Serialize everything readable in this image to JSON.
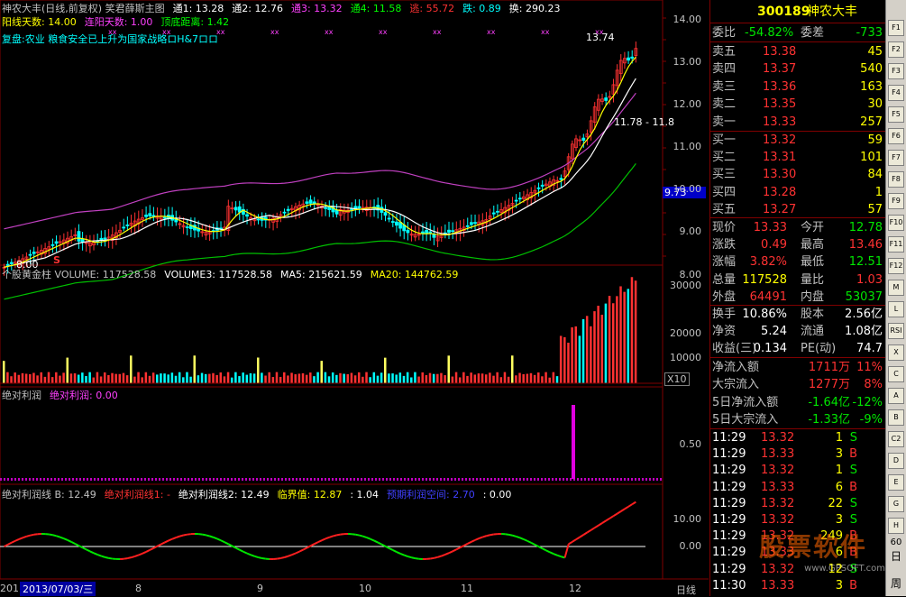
{
  "main_panel": {
    "header": [
      {
        "text": "神农大丰(日线,前复权) 笑君薛斯主图",
        "color": "#c0c0c0"
      },
      {
        "text": "通1: 13.28",
        "color": "#ffffff"
      },
      {
        "text": "通2: 12.76",
        "color": "#ffffff"
      },
      {
        "text": "通3: 13.32",
        "color": "#ff40ff"
      },
      {
        "text": "通4: 11.58",
        "color": "#00ff00"
      },
      {
        "text": "逃: 55.72",
        "color": "#ff3232"
      },
      {
        "text": "跌: 0.89",
        "color": "#00ffff"
      },
      {
        "text": "换: 290.23",
        "color": "#ffffff"
      }
    ],
    "header2": [
      {
        "text": "阳线天数: 14.00",
        "color": "#ffff00"
      },
      {
        "text": "连阳天数: 1.00",
        "color": "#ff40ff"
      },
      {
        "text": "顶底距离: 1.42",
        "color": "#00ff00"
      }
    ],
    "fupan": "复盘:农业 粮食安全已上升为国家战略ロH&7ロロ",
    "y_ticks": [
      "14.00",
      "13.00",
      "12.00",
      "11.00",
      "10.00",
      "9.00",
      "8.00"
    ],
    "high_label": "13.74",
    "mid_label": "11.78 - 11.8",
    "low_label": "8.00",
    "price_tag": "9.73",
    "s_marker": "S"
  },
  "volume_panel": {
    "header": [
      {
        "text": "个股黄金柱 VOLUME: 117528.58",
        "color": "#c0c0c0"
      },
      {
        "text": "VOLUME3: 117528.58",
        "color": "#ffffff"
      },
      {
        "text": "MA5: 215621.59",
        "color": "#ffffff"
      },
      {
        "text": "MA20: 144762.59",
        "color": "#ffff00"
      }
    ],
    "y_ticks": [
      "30000",
      "20000",
      "10000"
    ],
    "unit": "X10"
  },
  "profit_panel": {
    "header": [
      {
        "text": "绝对利润",
        "color": "#c0c0c0"
      },
      {
        "text": "绝对利润: 0.00",
        "color": "#ff40ff"
      }
    ],
    "y_ticks": [
      "0.50"
    ]
  },
  "line_panel": {
    "header": [
      {
        "text": "绝对利润线 B: 12.49",
        "color": "#c0c0c0"
      },
      {
        "text": "绝对利润线1: -",
        "color": "#ff3232"
      },
      {
        "text": "绝对利润线2: 12.49",
        "color": "#ffffff"
      },
      {
        "text": "临界值: 12.87",
        "color": "#ffff00"
      },
      {
        "text": ": 1.04",
        "color": "#ffffff"
      },
      {
        "text": "预期利润空间: 2.70",
        "color": "#4040ff"
      },
      {
        "text": ": 0.00",
        "color": "#ffffff"
      }
    ],
    "y_ticks": [
      "10.00",
      "0.00"
    ]
  },
  "x_axis": {
    "start": "201",
    "date": "2013/07/03/三",
    "months": [
      "8",
      "9",
      "10",
      "11",
      "12"
    ],
    "period": "日线"
  },
  "quote": {
    "code": "300189",
    "name": "神农大丰",
    "weibi_label": "委比",
    "weibi_value": "-54.82%",
    "weicha_label": "委差",
    "weicha_value": "-733",
    "sells": [
      {
        "label": "卖五",
        "price": "13.38",
        "vol": "45"
      },
      {
        "label": "卖四",
        "price": "13.37",
        "vol": "540"
      },
      {
        "label": "卖三",
        "price": "13.36",
        "vol": "163"
      },
      {
        "label": "卖二",
        "price": "13.35",
        "vol": "30"
      },
      {
        "label": "卖一",
        "price": "13.33",
        "vol": "257"
      }
    ],
    "buys": [
      {
        "label": "买一",
        "price": "13.32",
        "vol": "59"
      },
      {
        "label": "买二",
        "price": "13.31",
        "vol": "101"
      },
      {
        "label": "买三",
        "price": "13.30",
        "vol": "84"
      },
      {
        "label": "买四",
        "price": "13.28",
        "vol": "1"
      },
      {
        "label": "买五",
        "price": "13.27",
        "vol": "57"
      }
    ],
    "stats": [
      {
        "l1": "现价",
        "v1": "13.33",
        "c1": "#ff3232",
        "l2": "今开",
        "v2": "12.78",
        "c2": "#00e600"
      },
      {
        "l1": "涨跌",
        "v1": "0.49",
        "c1": "#ff3232",
        "l2": "最高",
        "v2": "13.46",
        "c2": "#ff3232"
      },
      {
        "l1": "涨幅",
        "v1": "3.82%",
        "c1": "#ff3232",
        "l2": "最低",
        "v2": "12.51",
        "c2": "#00e600"
      },
      {
        "l1": "总量",
        "v1": "117528",
        "c1": "#ffff00",
        "l2": "量比",
        "v2": "1.03",
        "c2": "#ff3232"
      },
      {
        "l1": "外盘",
        "v1": "64491",
        "c1": "#ff3232",
        "l2": "内盘",
        "v2": "53037",
        "c2": "#00e600"
      }
    ],
    "stats2": [
      {
        "l1": "换手",
        "v1": "10.86%",
        "l2": "股本",
        "v2": "2.56亿"
      },
      {
        "l1": "净资",
        "v1": "5.24",
        "l2": "流通",
        "v2": "1.08亿"
      },
      {
        "l1": "收益(三)",
        "v1": "0.134",
        "l2": "PE(动)",
        "v2": "74.7"
      }
    ],
    "flows": [
      {
        "label": "净流入额",
        "value": "1711万",
        "pct": "11%",
        "color": "#ff3232"
      },
      {
        "label": "大宗流入",
        "value": "1277万",
        "pct": "8%",
        "color": "#ff3232"
      },
      {
        "label": "5日净流入额",
        "value": "-1.64亿",
        "pct": "-12%",
        "color": "#00e600"
      },
      {
        "label": "5日大宗流入",
        "value": "-1.33亿",
        "pct": "-9%",
        "color": "#00e600"
      }
    ],
    "ticks": [
      {
        "time": "11:29",
        "price": "13.32",
        "vol": "1",
        "side": "S"
      },
      {
        "time": "11:29",
        "price": "13.33",
        "vol": "3",
        "side": "B"
      },
      {
        "time": "11:29",
        "price": "13.32",
        "vol": "1",
        "side": "S"
      },
      {
        "time": "11:29",
        "price": "13.33",
        "vol": "6",
        "side": "B"
      },
      {
        "time": "11:29",
        "price": "13.32",
        "vol": "22",
        "side": "S"
      },
      {
        "time": "11:29",
        "price": "13.32",
        "vol": "3",
        "side": "S"
      },
      {
        "time": "11:29",
        "price": "13.32",
        "vol": "249",
        "side": "B"
      },
      {
        "time": "11:29",
        "price": "13.33",
        "vol": "6",
        "side": "B"
      },
      {
        "time": "11:29",
        "price": "13.32",
        "vol": "12",
        "side": "S"
      },
      {
        "time": "11:30",
        "price": "13.33",
        "vol": "3",
        "side": "B"
      }
    ]
  },
  "toolbar": {
    "buttons": [
      "F1",
      "F2",
      "F3",
      "F4",
      "F5",
      "F6",
      "F7",
      "F8",
      "F9",
      "F10",
      "F11",
      "F12",
      "M",
      "L",
      "RSI",
      "X",
      "C",
      "A",
      "B",
      "C2",
      "D",
      "E",
      "G",
      "H"
    ],
    "labels": [
      "日",
      "周"
    ],
    "num": "60"
  },
  "watermark": {
    "title": "股票软件",
    "sub": "www.GPSOFT.com"
  }
}
